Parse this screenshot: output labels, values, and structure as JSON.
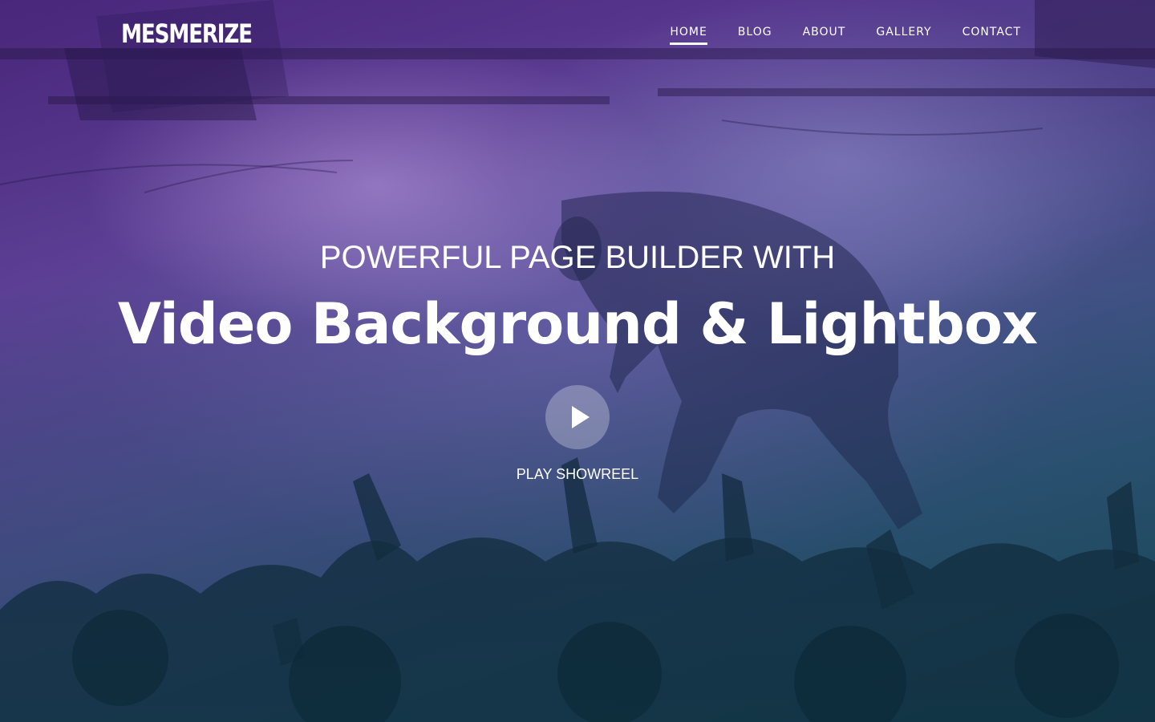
{
  "brand": {
    "logo_text": "MESMERIZE"
  },
  "nav": {
    "items": [
      {
        "label": "HOME",
        "active": true
      },
      {
        "label": "BLOG",
        "active": false
      },
      {
        "label": "ABOUT",
        "active": false
      },
      {
        "label": "GALLERY",
        "active": false
      },
      {
        "label": "CONTACT",
        "active": false
      }
    ]
  },
  "hero": {
    "subtitle": "POWERFUL PAGE BUILDER WITH",
    "title": "Video Background & Lightbox",
    "play_label": "PLAY SHOWREEL",
    "play_icon": "play-icon"
  },
  "colors": {
    "text": "#ffffff",
    "gradient_top": "#4a2a7c",
    "gradient_bottom": "#1d4a5a"
  }
}
